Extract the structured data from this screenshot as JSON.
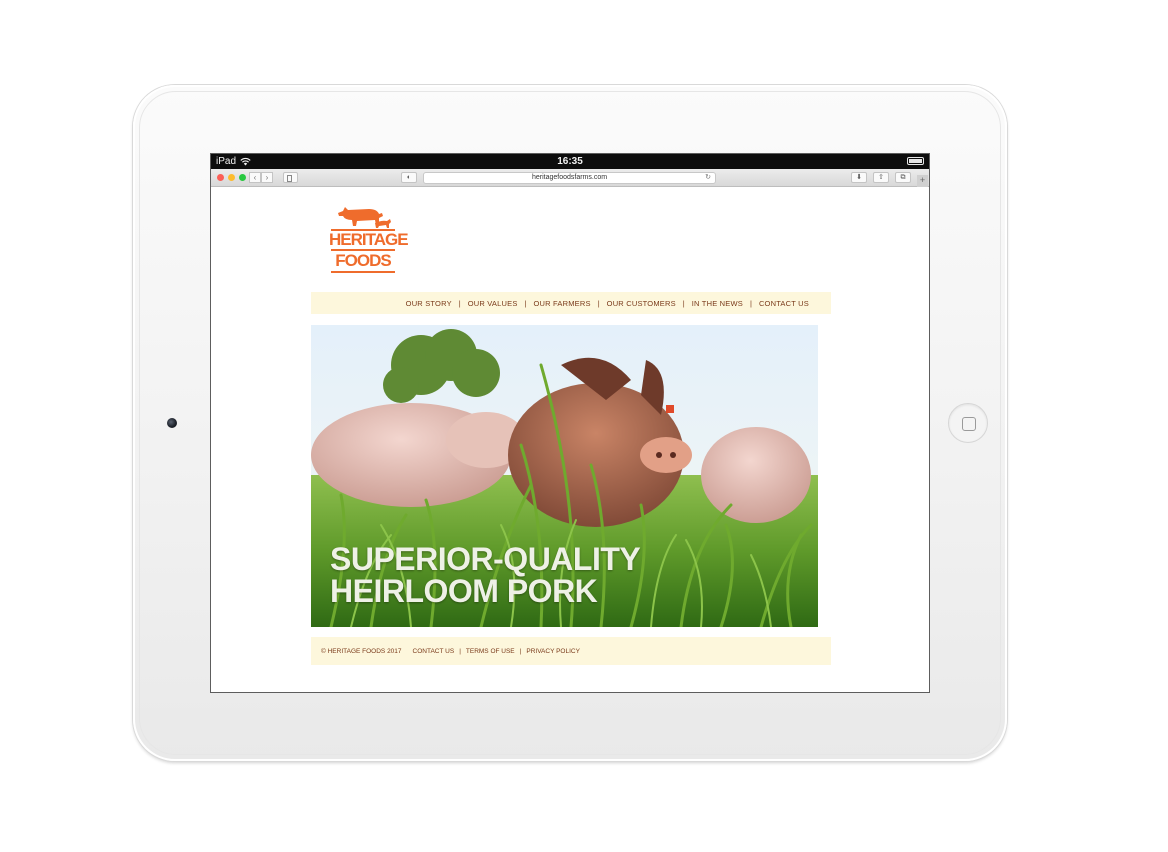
{
  "device": {
    "carrier": "iPad",
    "time": "16:35"
  },
  "browser": {
    "url": "heritagefoodsfarms.com"
  },
  "logo": {
    "line1": "HERITAGE",
    "line2": "FOODS",
    "color": "#ef6c2c"
  },
  "nav": {
    "items": [
      {
        "label": "OUR STORY"
      },
      {
        "label": "OUR VALUES"
      },
      {
        "label": "OUR FARMERS"
      },
      {
        "label": "OUR CUSTOMERS"
      },
      {
        "label": "IN THE NEWS"
      },
      {
        "label": "CONTACT US"
      }
    ],
    "separator": "|",
    "background": "#fdf7dc",
    "text_color": "#7a3a1a"
  },
  "hero": {
    "headline_line1": "SUPERIOR-QUALITY",
    "headline_line2": "HEIRLOOM PORK"
  },
  "footer": {
    "copyright": "© HERITAGE FOODS 2017",
    "links": [
      {
        "label": "CONTACT US"
      },
      {
        "label": "TERMS OF USE"
      },
      {
        "label": "PRIVACY POLICY"
      }
    ],
    "separator": "|"
  }
}
